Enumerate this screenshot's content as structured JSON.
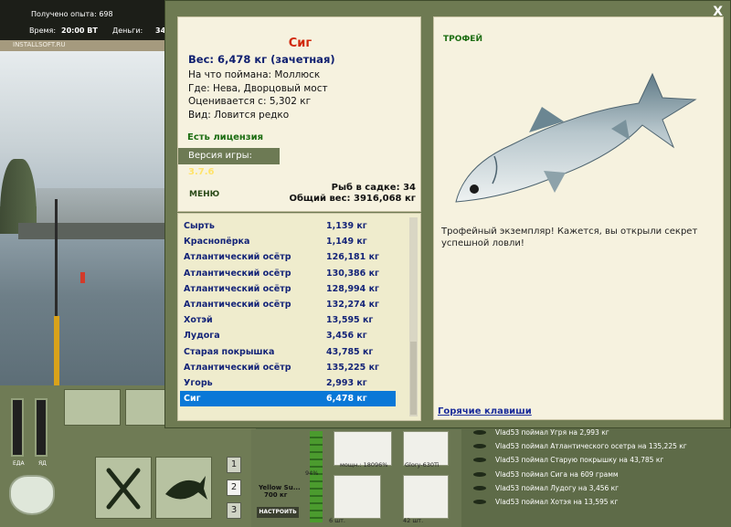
{
  "topbar": {
    "xp": "Получено опыта: 698",
    "time_label": "Время:",
    "time_value": "20:00 ВТ",
    "money_label": "Деньги:",
    "money_value": "34"
  },
  "watermark": "INSTALLSOFT.RU",
  "meters": {
    "food_label": "ЕДА",
    "bait_label": "ЯД"
  },
  "hotbar": {
    "slot1": "1",
    "slot2": "2",
    "slot3": "3"
  },
  "tackle": {
    "rod_name": "Yellow Su...",
    "rod_weight": "700 кг",
    "rod_pct": "94%",
    "set_label": "НАСТРОИТЬ",
    "reel_label": "мощн.: 180",
    "reel_pct": "96%",
    "line_label": "Glory-630Ti",
    "hooks_count": "6 шт.",
    "bait_count": "42 шт."
  },
  "popup": {
    "close_label": "X",
    "fish_name": "Сиг",
    "fish_weight": "Вес: 6,478 кг (зачетная)",
    "info": {
      "bait": "На что поймана: Моллюск",
      "place": "Где: Нева, Дворцовый мост",
      "value": "Оценивается с: 5,302 кг",
      "kind": "Вид: Ловится редко"
    },
    "license": "Есть лицензия",
    "version_label": "Версия игры:",
    "version_value": "3.7.6",
    "menu_label": "МЕНЮ",
    "keep_count": "Рыб в садке: 34",
    "keep_total": "Общий вес: 3916,068 кг",
    "catch_list": [
      {
        "name": "Сырть",
        "weight": "1,139 кг"
      },
      {
        "name": "Краснопёрка",
        "weight": "1,149 кг"
      },
      {
        "name": "Атлантический осётр",
        "weight": "126,181 кг"
      },
      {
        "name": "Атлантический осётр",
        "weight": "130,386 кг"
      },
      {
        "name": "Атлантический осётр",
        "weight": "128,994 кг"
      },
      {
        "name": "Атлантический осётр",
        "weight": "132,274 кг"
      },
      {
        "name": "Хотэй",
        "weight": "13,595 кг"
      },
      {
        "name": "Лудога",
        "weight": "3,456 кг"
      },
      {
        "name": "Старая покрышка",
        "weight": "43,785 кг"
      },
      {
        "name": "Атлантический осётр",
        "weight": "135,225 кг"
      },
      {
        "name": "Угорь",
        "weight": "2,993 кг"
      },
      {
        "name": "Сиг",
        "weight": "6,478 кг"
      }
    ],
    "selected_index": 11,
    "trophy_title": "ТРОФЕЙ",
    "trophy_text": "Трофейный экземпляр! Кажется, вы открыли секрет успешной ловли!",
    "hotkeys_label": "Горячие клавиши"
  },
  "log": [
    "Vlad53 поймал Угря на 2,993 кг",
    "Vlad53 поймал Атлантического осетра на 135,225 кг",
    "Vlad53 поймал Старую покрышку на 43,785 кг",
    "Vlad53 поймал Сига на 609 грамм",
    "Vlad53 поймал Лудогу на 3,456 кг",
    "Vlad53 поймал Хотэя на 13,595 кг"
  ],
  "colors": {
    "fish_title": "#d1280d",
    "selected_row": "#0a78d7",
    "catch_text": "#142478",
    "license": "#1c6d12"
  }
}
